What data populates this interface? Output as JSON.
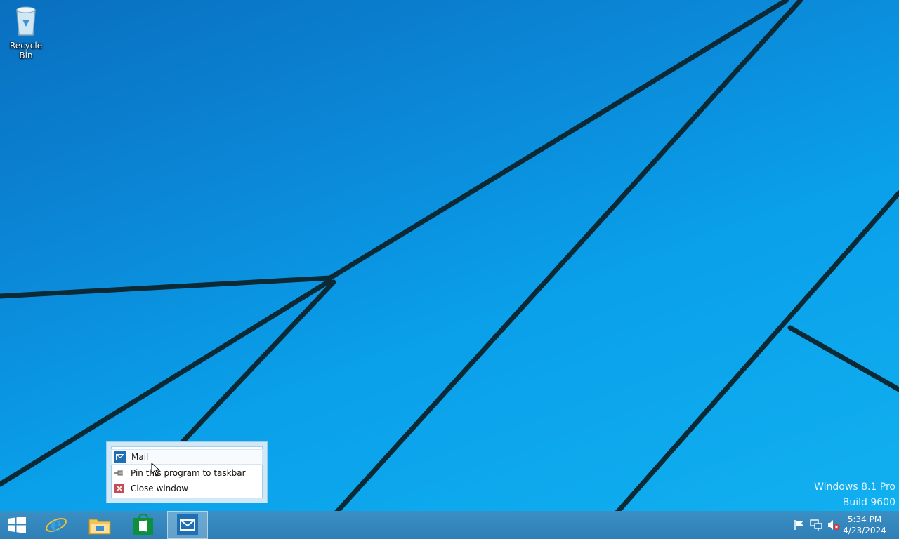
{
  "desktop": {
    "icons": [
      {
        "label": "Recycle Bin",
        "icon": "recycle-bin-icon"
      }
    ],
    "watermark": {
      "line1": "Windows 8.1 Pro",
      "line2": "Build 9600"
    }
  },
  "jump_list": {
    "items": [
      {
        "label": "Mail",
        "icon": "mail-icon"
      },
      {
        "label": "Pin this program to taskbar",
        "icon": "pin-icon"
      },
      {
        "label": "Close window",
        "icon": "close-icon"
      }
    ]
  },
  "taskbar": {
    "buttons": [
      {
        "name": "start",
        "icon": "windows-logo-icon"
      },
      {
        "name": "internet-explorer",
        "icon": "internet-explorer-icon"
      },
      {
        "name": "file-explorer",
        "icon": "folder-icon"
      },
      {
        "name": "store",
        "icon": "store-icon"
      },
      {
        "name": "mail",
        "icon": "mail-icon",
        "active": true
      }
    ],
    "tray": {
      "icons": [
        "flag-icon",
        "network-icon",
        "speaker-muted-icon"
      ],
      "time": "5:34 PM",
      "date": "4/23/2024"
    }
  },
  "colors": {
    "accent": "#1a9de0",
    "taskbar": "#2f7fb6"
  }
}
